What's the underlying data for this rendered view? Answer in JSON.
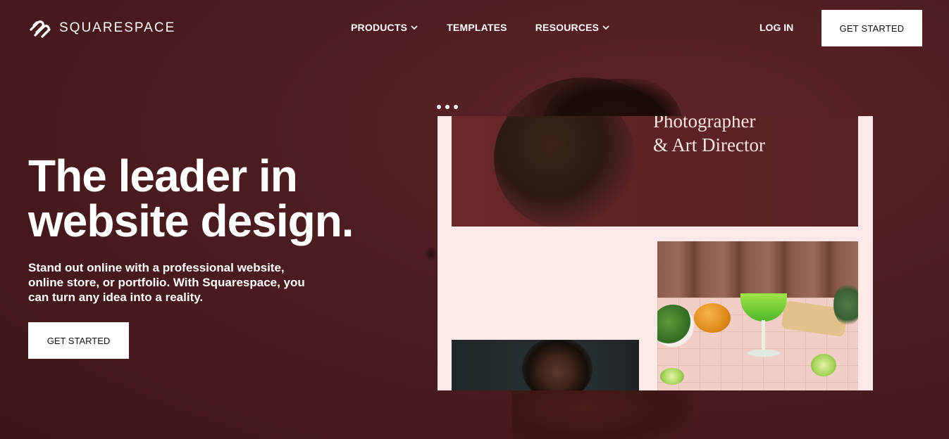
{
  "brand": {
    "name": "SQUARESPACE",
    "logo_icon": "squarespace-logo-icon"
  },
  "nav": {
    "links": [
      {
        "label": "PRODUCTS",
        "has_dropdown": true
      },
      {
        "label": "TEMPLATES",
        "has_dropdown": false
      },
      {
        "label": "RESOURCES",
        "has_dropdown": true
      }
    ],
    "login_label": "LOG IN",
    "cta_label": "GET STARTED"
  },
  "hero": {
    "headline_line1": "The leader in",
    "headline_line2": "website design.",
    "subtext": "Stand out online with a professional website, online store, or portfolio. With Squarespace, you can turn any idea into a reality.",
    "cta_label": "GET STARTED"
  },
  "mockup": {
    "title_line1": "Photographer",
    "title_line2": "& Art Director"
  },
  "colors": {
    "background": "#4c1c20",
    "button_bg": "#ffffff",
    "button_text": "#111111",
    "mockup_bg": "#fde9e7"
  }
}
